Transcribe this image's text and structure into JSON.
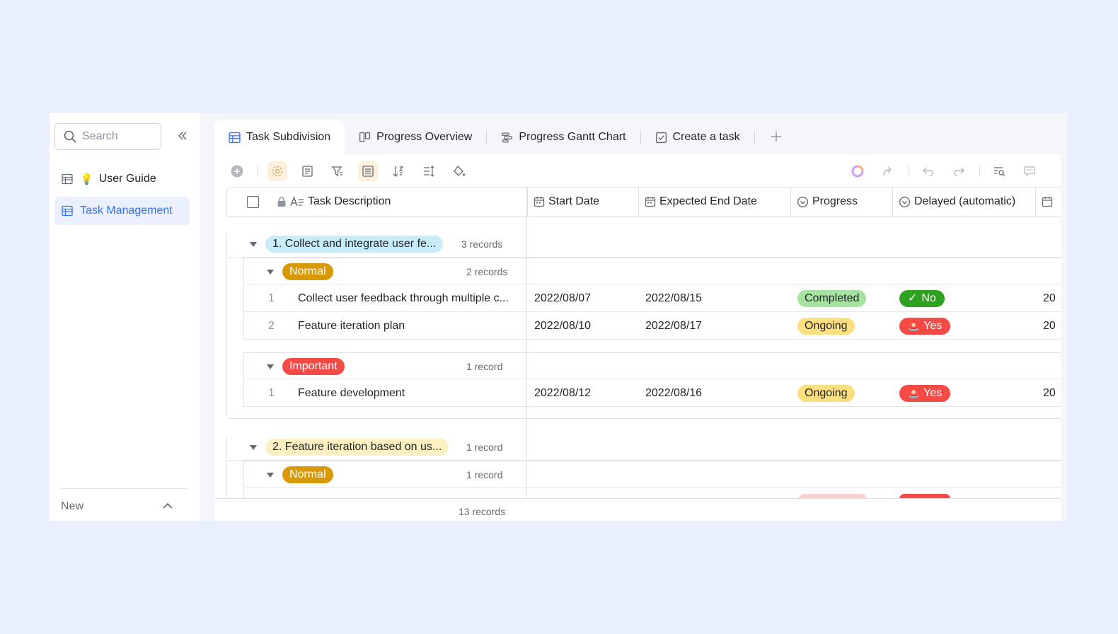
{
  "sidebar": {
    "search_placeholder": "Search",
    "items": [
      {
        "label": "User Guide",
        "emoji": "💡"
      },
      {
        "label": "Task Management"
      }
    ],
    "new_label": "New"
  },
  "tabs": [
    {
      "label": "Task Subdivision"
    },
    {
      "label": "Progress Overview"
    },
    {
      "label": "Progress Gantt Chart"
    },
    {
      "label": "Create a task"
    }
  ],
  "columns": {
    "task": "Task Description",
    "start": "Start Date",
    "end": "Expected End Date",
    "progress": "Progress",
    "delayed": "Delayed (automatic)"
  },
  "groups": [
    {
      "title": "1. Collect and integrate user fe...",
      "count": "3 records",
      "subgroups": [
        {
          "label": "Normal",
          "count": "2 records",
          "rows": [
            {
              "num": "1",
              "task": "Collect user feedback through multiple c...",
              "start": "2022/08/07",
              "end": "2022/08/15",
              "progress": "Completed",
              "delayed": "No",
              "next": "20"
            },
            {
              "num": "2",
              "task": "Feature iteration plan",
              "start": "2022/08/10",
              "end": "2022/08/17",
              "progress": "Ongoing",
              "delayed": "Yes",
              "next": "20"
            }
          ]
        },
        {
          "label": "Important",
          "count": "1 record",
          "rows": [
            {
              "num": "1",
              "task": "Feature development",
              "start": "2022/08/12",
              "end": "2022/08/16",
              "progress": "Ongoing",
              "delayed": "Yes",
              "next": "20"
            }
          ]
        }
      ]
    },
    {
      "title": "2. Feature iteration based on us...",
      "count": "1 record",
      "subgroups": [
        {
          "label": "Normal",
          "count": "1 record"
        }
      ]
    }
  ],
  "footer": {
    "total": "13 records"
  },
  "colors": {
    "accent": "#3370ff",
    "normal": "#d99904",
    "important": "#f54a45",
    "completed": "#a6e3a0",
    "ongoing": "#fcdf7e",
    "no": "#2ea121",
    "yes": "#f54a45",
    "group1": "#c9ecfb",
    "group2": "#fcefc2"
  }
}
